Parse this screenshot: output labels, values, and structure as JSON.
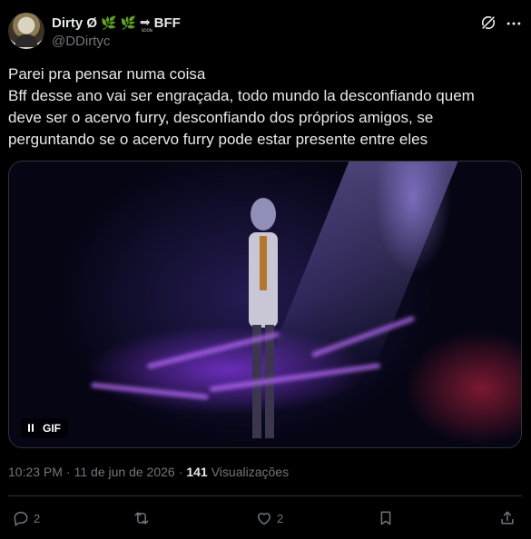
{
  "author": {
    "display_name": "Dirty Ø",
    "emojis": [
      "🌿",
      "🌿"
    ],
    "soon_arrow": "➡",
    "soon_text": "SOON",
    "suffix": "BFF",
    "handle": "@DDirtyc"
  },
  "tweet": {
    "lines": [
      "Parei pra pensar numa coisa",
      "Bff desse ano vai ser engraçada, todo mundo la desconfiando quem",
      "deve ser o acervo furry, desconfiando dos próprios amigos, se",
      "perguntando se o acervo furry pode estar presente entre eles"
    ]
  },
  "media": {
    "badge_label": "GIF"
  },
  "meta": {
    "time": "10:23 PM",
    "separator": "·",
    "date": "11 de jun de 2026",
    "views_count": "141",
    "views_label": "Visualizações"
  },
  "actions": {
    "reply_count": "2",
    "like_count": "2"
  },
  "colors": {
    "background": "#000000",
    "text_primary": "#e7e9ea",
    "text_secondary": "#71767b",
    "divider": "#2f3336"
  }
}
